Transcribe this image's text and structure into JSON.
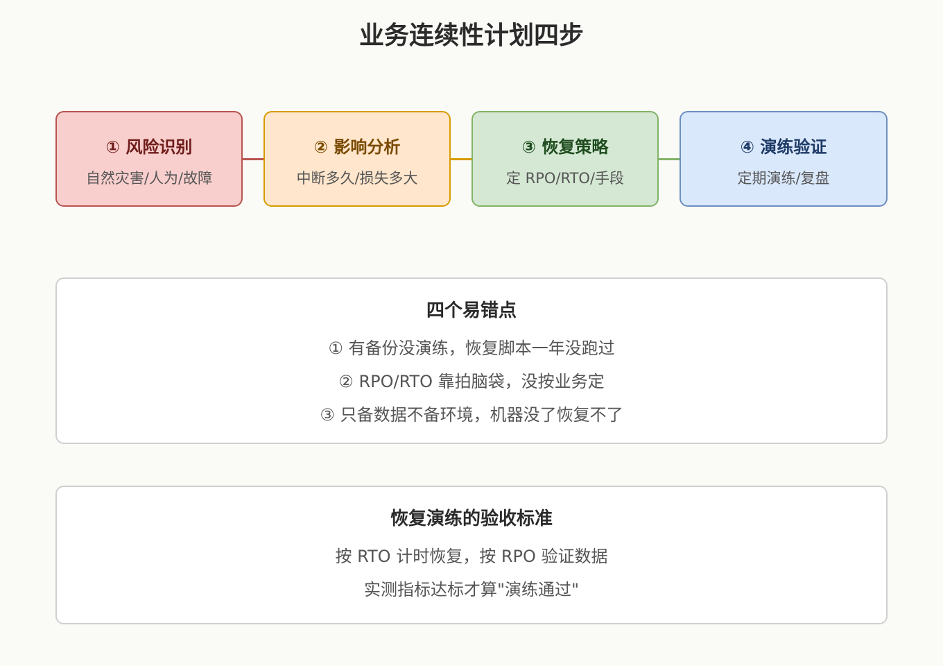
{
  "title": "业务连续性计划四步",
  "steps": [
    {
      "title": "① 风险识别",
      "desc": "自然灾害/人为/故障",
      "color": "#b85450",
      "fill": "#f8cfcd"
    },
    {
      "title": "② 影响分析",
      "desc": "中断多久/损失多大",
      "color": "#d79b00",
      "fill": "#ffe6cc"
    },
    {
      "title": "③ 恢复策略",
      "desc": "定 RPO/RTO/手段",
      "color": "#82b366",
      "fill": "#d5e8d4"
    },
    {
      "title": "④ 演练验证",
      "desc": "定期演练/复盘",
      "color": "#6c8ebf",
      "fill": "#dae8fc"
    }
  ],
  "mistakes": {
    "title": "四个易错点",
    "items": [
      "① 有备份没演练，恢复脚本一年没跑过",
      "② RPO/RTO 靠拍脑袋，没按业务定",
      "③ 只备数据不备环境，机器没了恢复不了"
    ]
  },
  "criteria": {
    "title": "恢复演练的验收标准",
    "lines": [
      "按 RTO 计时恢复，按 RPO 验证数据",
      "实测指标达标才算\"演练通过\""
    ]
  }
}
